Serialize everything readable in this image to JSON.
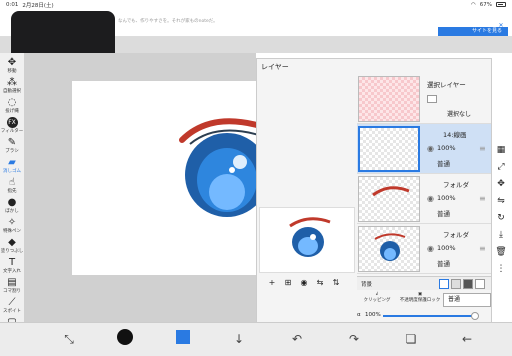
{
  "status": {
    "time": "0:01",
    "date": "2月28日(土)",
    "battery": "67%"
  },
  "ad": {
    "text": "なんでも、作りやすさを。それが家ものnoteだ。",
    "button": "サイトを見る",
    "close": "✕"
  },
  "left_toolbar": [
    {
      "label": "移動",
      "icon": "move-icon"
    },
    {
      "label": "自動選択",
      "icon": "magic-wand-icon"
    },
    {
      "label": "投げ縄",
      "icon": "lasso-icon"
    },
    {
      "label": "フィルター",
      "icon": "fx-icon"
    },
    {
      "label": "ブラシ",
      "icon": "brush-icon"
    },
    {
      "label": "消しゴム",
      "icon": "eraser-icon",
      "active": true
    },
    {
      "label": "指先",
      "icon": "finger-icon"
    },
    {
      "label": "ぼかし",
      "icon": "blur-icon"
    },
    {
      "label": "特殊ペン",
      "icon": "special-pen-icon"
    },
    {
      "label": "塗りつぶし",
      "icon": "fill-icon"
    },
    {
      "label": "文字入れ",
      "icon": "text-icon"
    },
    {
      "label": "コマ割り",
      "icon": "frame-icon"
    },
    {
      "label": "スポイト",
      "icon": "eyedropper-icon"
    },
    {
      "label": "キャンバス",
      "icon": "canvas-icon"
    }
  ],
  "layer_panel": {
    "title": "レイヤー",
    "layers": [
      {
        "name": "選択レイヤー",
        "opacity": "",
        "mode": "選択なし",
        "type": "selection"
      },
      {
        "name": "14:線画",
        "opacity": "100%",
        "mode": "普通",
        "type": "selected"
      },
      {
        "name": "フォルダ",
        "opacity": "100%",
        "mode": "普通",
        "type": "folder"
      },
      {
        "name": "フォルダ",
        "opacity": "100%",
        "mode": "普通",
        "type": "folder"
      }
    ],
    "background_label": "背景",
    "clipping_label": "クリッピング",
    "protect_label": "不透明度保護ロック",
    "blend_mode": "普通",
    "alpha_label": "α",
    "alpha_value": "100%"
  },
  "accent": "#2a7ae2"
}
